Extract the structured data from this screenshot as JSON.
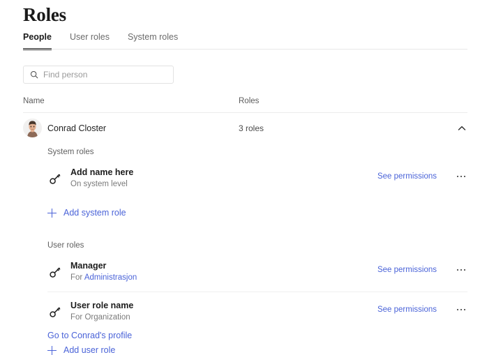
{
  "page": {
    "title": "Roles"
  },
  "tabs": [
    {
      "label": "People",
      "active": true
    },
    {
      "label": "User roles",
      "active": false
    },
    {
      "label": "System roles",
      "active": false
    }
  ],
  "search": {
    "placeholder": "Find person",
    "value": "",
    "icon": "search-icon"
  },
  "table": {
    "columns": {
      "name": "Name",
      "roles": "Roles"
    },
    "person": {
      "name": "Conrad Closter",
      "roles_count": "3 roles",
      "expanded": true,
      "collapse_icon": "chevron-up-icon",
      "avatar": "user-photo-avatar"
    }
  },
  "system_roles": {
    "label": "System roles",
    "items": [
      {
        "icon": "key-icon",
        "title": "Add name here",
        "subtitle_prefix": "On system level",
        "subtitle_link": "",
        "permissions_label": "See permissions",
        "more_icon": "ellipsis-icon"
      }
    ],
    "add_label": "Add system role"
  },
  "user_roles": {
    "label": "User roles",
    "items": [
      {
        "icon": "key-icon",
        "title": "Manager",
        "subtitle_prefix": "For ",
        "subtitle_link": "Administrasjon",
        "permissions_label": "See permissions",
        "more_icon": "ellipsis-icon"
      },
      {
        "icon": "key-icon",
        "title": "User role name",
        "subtitle_prefix": "For Organization",
        "subtitle_link": "",
        "permissions_label": "See permissions",
        "more_icon": "ellipsis-icon"
      }
    ],
    "add_label": "Add user role"
  },
  "footer": {
    "profile_link": "Go to Conrad's profile"
  },
  "colors": {
    "link": "#4a63d8",
    "text": "#222222",
    "muted": "#7a7a7a",
    "divider": "#ececec",
    "active_tab_underline": "#333333"
  }
}
